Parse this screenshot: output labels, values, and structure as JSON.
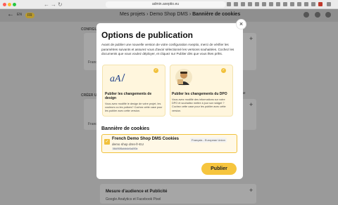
{
  "browser": {
    "url": "admin.axeptio.eu"
  },
  "header": {
    "lang_en": "EN",
    "lang_fr": "FR",
    "crumb_1": "Mes projets",
    "crumb_2": "Demo Shop DMS",
    "crumb_3": "Bannière de cookies"
  },
  "background": {
    "section_1": "CONFIGU",
    "section_2": "CRÉER UI",
    "card_prefix_1": "Franc",
    "card_prefix_2": "Franc",
    "filter": "ne",
    "bottom_card_title": "Mesure d'audience et Publicité",
    "bottom_card_sub": "Google Analytics et Facebook Pixel"
  },
  "modal": {
    "title": "Options de publication",
    "description": "Avant de publier une nouvelle version de votre configuration Axeptio, merci de vérifier les paramètres suivants et assurez vous d'avoir sélectionné les versions souhaitées. Cochez les documents que vous voulez déployer, et cliquez sur Publier dès que vous êtes prêts.",
    "options": [
      {
        "title": "Publier les changements de design",
        "description": "Vous avez modifié le design de votre projet, les couleurs ou les polices? Cochez cette case pour les publier avec cette version."
      },
      {
        "title": "Publier les changements du DPO",
        "description": "Vous avez modifié des informations sur votre DPO et souhaitez mettre à jour son widget ? Cochez cette case pour les publier avec cette version."
      }
    ],
    "section_title": "Bannière de cookies",
    "cookie": {
      "name": "French Demo Shop DMS Cookies",
      "subtitle": "demo shop dms-fr-EU",
      "id": "5f4d9f0f5abbb4e5a49f3e",
      "badge": "Français - European Union"
    },
    "publish_label": "Publier",
    "close_label": "×"
  },
  "colors": {
    "accent": "#f6c53e",
    "option_bg": "#fff6dd"
  }
}
